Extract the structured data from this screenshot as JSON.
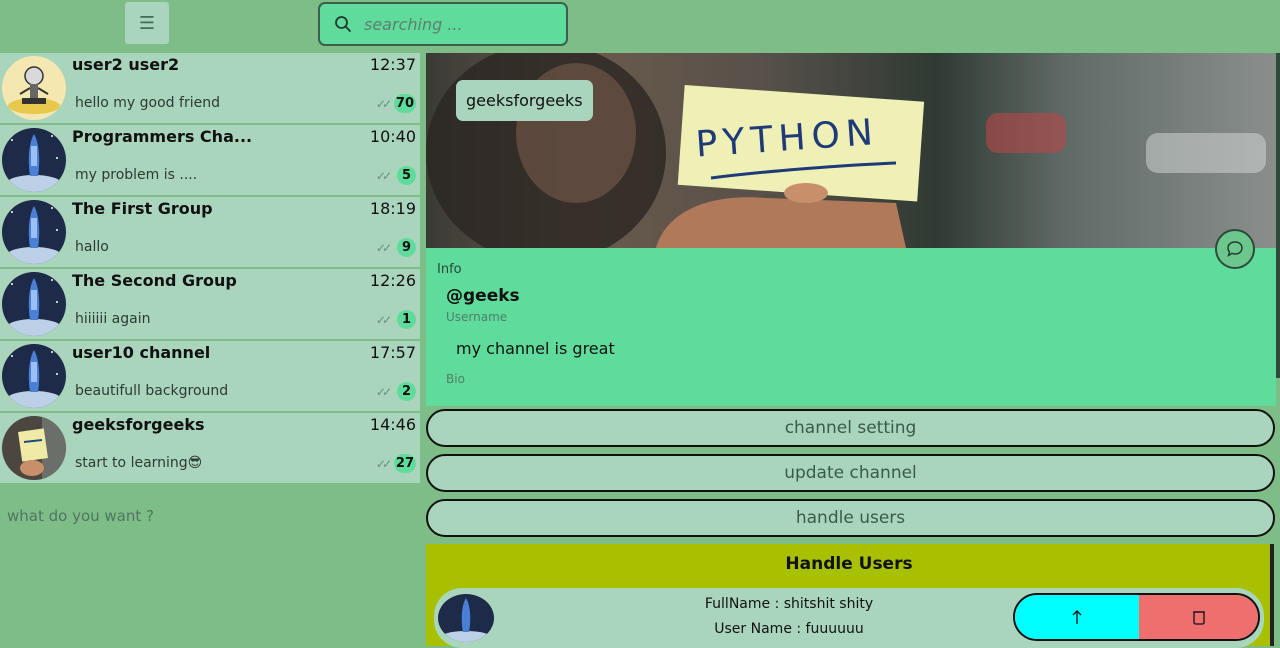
{
  "header": {
    "menu_icon": "hamburger-icon",
    "search_placeholder": "searching ...",
    "search_icon": "search-icon"
  },
  "chats": [
    {
      "name": "user2 user2",
      "time": "12:37",
      "message": "hello my good friend",
      "unread": "70",
      "avatar": "robot-avatar"
    },
    {
      "name": "Programmers Cha...",
      "time": "10:40",
      "message": "my problem is ....",
      "unread": "5",
      "avatar": "rocket-avatar"
    },
    {
      "name": "The First Group",
      "time": "18:19",
      "message": "hallo",
      "unread": "9",
      "avatar": "rocket-avatar"
    },
    {
      "name": "The Second Group",
      "time": "12:26",
      "message": "hiiiiii again",
      "unread": "1",
      "avatar": "rocket-avatar"
    },
    {
      "name": "user10 channel",
      "time": "17:57",
      "message": "beautifull background",
      "unread": "2",
      "avatar": "rocket-avatar"
    },
    {
      "name": "geeksforgeeks",
      "time": "14:46",
      "message": "start to learning😎",
      "unread": "27",
      "avatar": "python-avatar"
    }
  ],
  "sidebar_prompt": "what do you want ?",
  "channel": {
    "title": "geeksforgeeks",
    "banner_text": "PYTHON",
    "info_label": "Info",
    "username": "@geeks",
    "username_caption": "Username",
    "bio": "my channel is great",
    "bio_caption": "Bio"
  },
  "buttons": {
    "setting": "channel setting",
    "update": "update channel",
    "handle": "handle users"
  },
  "handle_users": {
    "title": "Handle Users",
    "users": [
      {
        "fullname": "FullName : shitshit shity",
        "username": "User Name : fuuuuuu"
      }
    ]
  },
  "colors": {
    "background": "#7fbd88",
    "panel": "#a9d5bd",
    "accent": "#5fdc9c",
    "handle_panel": "#a8c000",
    "promote": "#00ffff",
    "delete": "#ef6e6e"
  }
}
